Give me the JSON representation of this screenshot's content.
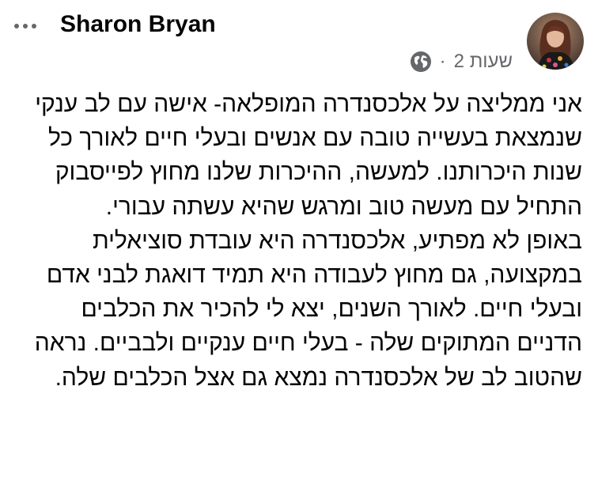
{
  "post": {
    "author_name": "Sharon Bryan",
    "timestamp": "2 שעות",
    "separator": "·",
    "privacy_icon": "globe-icon",
    "paragraphs": [
      "אני ממליצה על אלכסנדרה המופלאה- אישה עם לב ענקי שנמצאת בעשייה טובה עם אנשים ובעלי חיים לאורך כל שנות היכרותנו. למעשה, ההיכרות שלנו מחוץ לפייסבוק התחיל עם מעשה טוב ומרגש שהיא עשתה עבורי.",
      "באופן לא מפתיע, אלכסנדרה היא עובדת סוציאלית במקצועה, גם מחוץ לעבודה היא תמיד דואגת לבני אדם ובעלי חיים. לאורך השנים, יצא לי להכיר את הכלבים הדניים המתוקים שלה - בעלי חיים ענקיים ולבביים. נראה שהטוב לב של אלכסנדרה נמצא גם אצל הכלבים שלה."
    ]
  },
  "colors": {
    "text_primary": "#050505",
    "text_secondary": "#65676b",
    "background": "#ffffff"
  }
}
